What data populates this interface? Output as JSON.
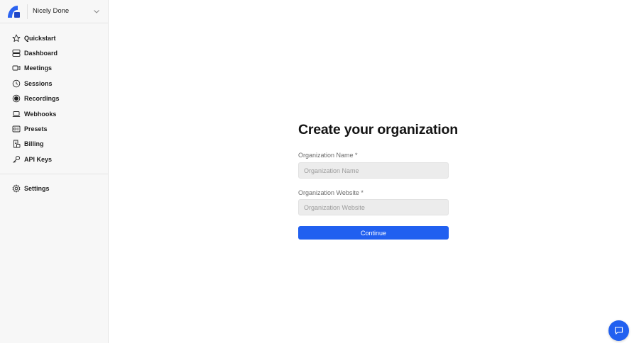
{
  "org": {
    "name": "Nicely Done"
  },
  "nav": {
    "items": [
      {
        "label": "Quickstart",
        "icon": "star-icon"
      },
      {
        "label": "Dashboard",
        "icon": "dashboard-icon"
      },
      {
        "label": "Meetings",
        "icon": "video-camera-icon"
      },
      {
        "label": "Sessions",
        "icon": "clock-icon"
      },
      {
        "label": "Recordings",
        "icon": "record-icon"
      },
      {
        "label": "Webhooks",
        "icon": "laptop-icon"
      },
      {
        "label": "Presets",
        "icon": "presets-icon"
      },
      {
        "label": "Billing",
        "icon": "billing-icon"
      },
      {
        "label": "API Keys",
        "icon": "key-icon"
      }
    ],
    "settings": {
      "label": "Settings",
      "icon": "gear-icon"
    }
  },
  "form": {
    "title": "Create your organization",
    "org_name_label": "Organization Name *",
    "org_name_placeholder": "Organization Name",
    "org_name_value": "",
    "website_label": "Organization Website *",
    "website_placeholder": "Organization Website",
    "website_value": "",
    "continue_label": "Continue"
  },
  "colors": {
    "accent": "#2160f0",
    "sidebar_bg": "#f7f7f7",
    "input_bg": "#ececec"
  }
}
